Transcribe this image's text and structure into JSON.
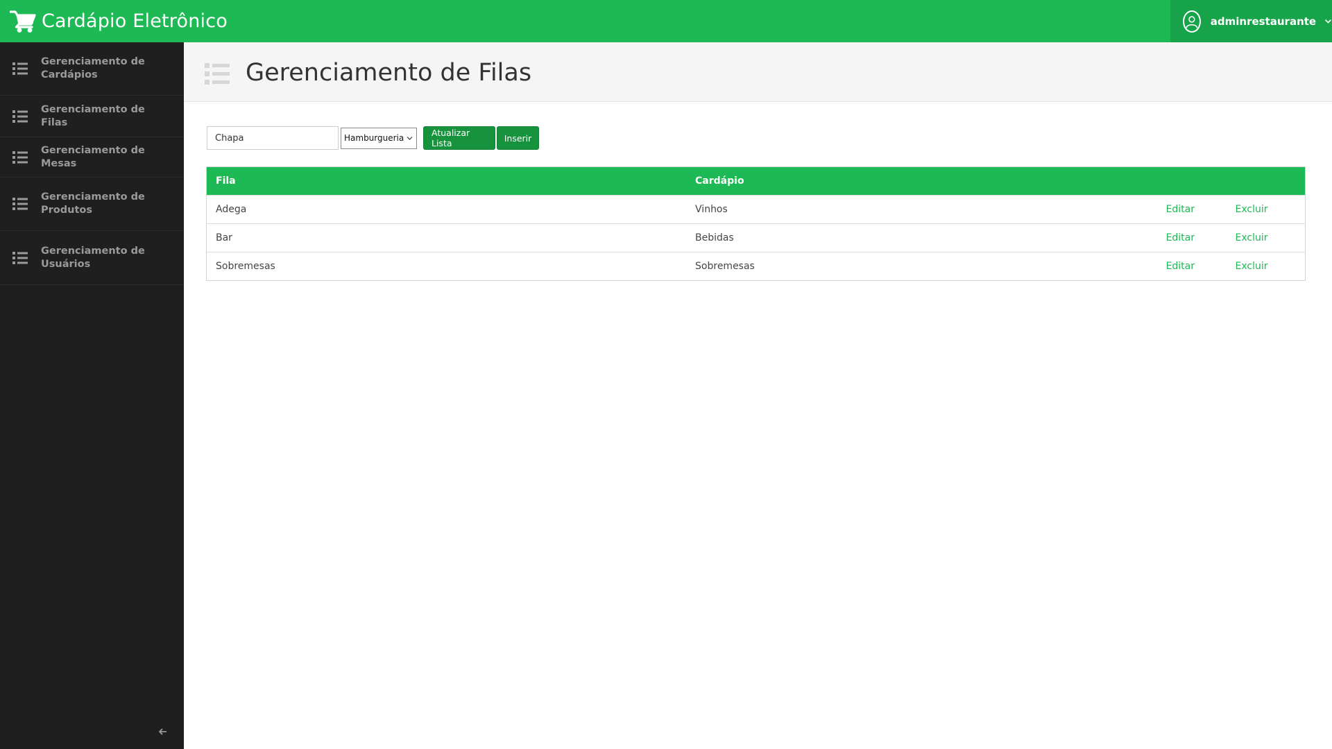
{
  "app": {
    "title": "Cardápio Eletrônico",
    "brand_color": "#1db954"
  },
  "user": {
    "name": "adminrestaurante"
  },
  "sidebar": {
    "items": [
      {
        "label": "Gerenciamento de Cardápios",
        "icon": "list-icon"
      },
      {
        "label": "Gerenciamento de Filas",
        "icon": "list-icon"
      },
      {
        "label": "Gerenciamento de Mesas",
        "icon": "list-icon"
      },
      {
        "label": "Gerenciamento de Produtos",
        "icon": "list-icon"
      },
      {
        "label": "Gerenciamento de Usuários",
        "icon": "list-icon"
      }
    ]
  },
  "page": {
    "title": "Gerenciamento de Filas"
  },
  "toolbar": {
    "name_input_value": "Chapa",
    "cardapio_selected": "Hamburgueria",
    "update_label": "Atualizar Lista",
    "insert_label": "Inserir"
  },
  "table": {
    "headers": {
      "fila": "Fila",
      "cardapio": "Cardápio"
    },
    "rows": [
      {
        "fila": "Adega",
        "cardapio": "Vinhos",
        "edit": "Editar",
        "delete": "Excluir"
      },
      {
        "fila": "Bar",
        "cardapio": "Bebidas",
        "edit": "Editar",
        "delete": "Excluir"
      },
      {
        "fila": "Sobremesas",
        "cardapio": "Sobremesas",
        "edit": "Editar",
        "delete": "Excluir"
      }
    ]
  }
}
